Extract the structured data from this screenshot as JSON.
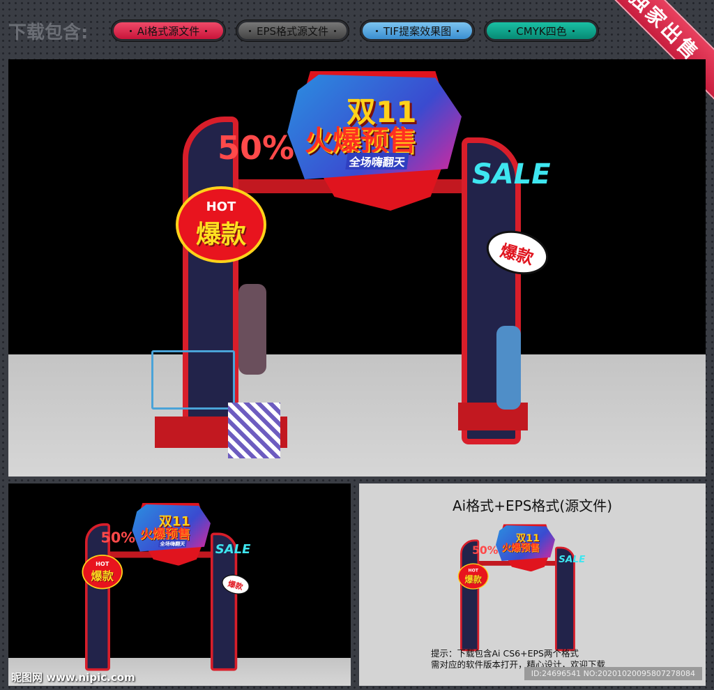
{
  "header": {
    "label": "下载包含:",
    "badges": [
      {
        "label": "Ai格式源文件",
        "color": "#e0244a"
      },
      {
        "label": "EPS格式源文件",
        "color": "#5a5a5c"
      },
      {
        "label": "TIF提案效果图",
        "color": "#4aa3e0"
      },
      {
        "label": "CMYK四色",
        "color": "#0aa08a"
      }
    ],
    "ribbon": "独家出售"
  },
  "arch": {
    "title": "双11",
    "subtitle": "火爆预售",
    "tagline": "全场嗨翻天",
    "discount": "50%",
    "sale": "SALE",
    "hot": "HOT",
    "hot_text": "爆款",
    "burst": "爆款"
  },
  "preview": {
    "caption": "Ai格式+EPS格式(源文件)",
    "tip_line1": "提示：下载包含Ai CS6+EPS两个格式",
    "tip_line2": "需对应的软件版本打开，精心设计，欢迎下载",
    "id_text": "ID:24696541 NO:20201020095807278084"
  },
  "watermark": "昵图网 www.nipic.com"
}
